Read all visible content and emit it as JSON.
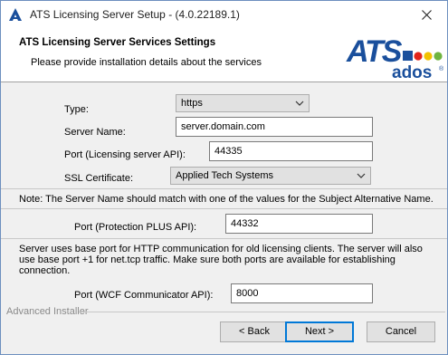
{
  "window": {
    "title": "ATS Licensing Server Setup - (4.0.22189.1)"
  },
  "header": {
    "title": "ATS Licensing Server Services Settings",
    "subtitle": "Please provide installation details about the services",
    "logo": {
      "top_text": "ATS",
      "bottom_text": "ados",
      "registered_mark": "®",
      "colors": {
        "blue": "#1a4f9c",
        "red": "#e2231a",
        "yellow": "#f2c100",
        "green": "#6fb43f"
      }
    }
  },
  "form": {
    "type": {
      "label": "Type:",
      "value": "https"
    },
    "server_name": {
      "label": "Server Name:",
      "value": "server.domain.com"
    },
    "port_api": {
      "label": "Port (Licensing server API):",
      "value": "44335"
    },
    "ssl_certificate": {
      "label": "SSL Certificate:",
      "value": "Applied Tech Systems"
    },
    "note": "Note: The Server Name should match with one of the values for the Subject Alternative Name.",
    "port_protection": {
      "label": "Port (Protection PLUS API):",
      "value": "44332"
    },
    "info": "Server uses base port for HTTP communication for old licensing clients. The server will also use base port +1 for net.tcp traffic. Make sure both ports are available for establishing connection.",
    "port_wcf": {
      "label": "Port (WCF Communicator API):",
      "value": "8000"
    }
  },
  "footer": {
    "installer_label": "Advanced Installer",
    "back": "< Back",
    "next": "Next >",
    "cancel": "Cancel"
  }
}
